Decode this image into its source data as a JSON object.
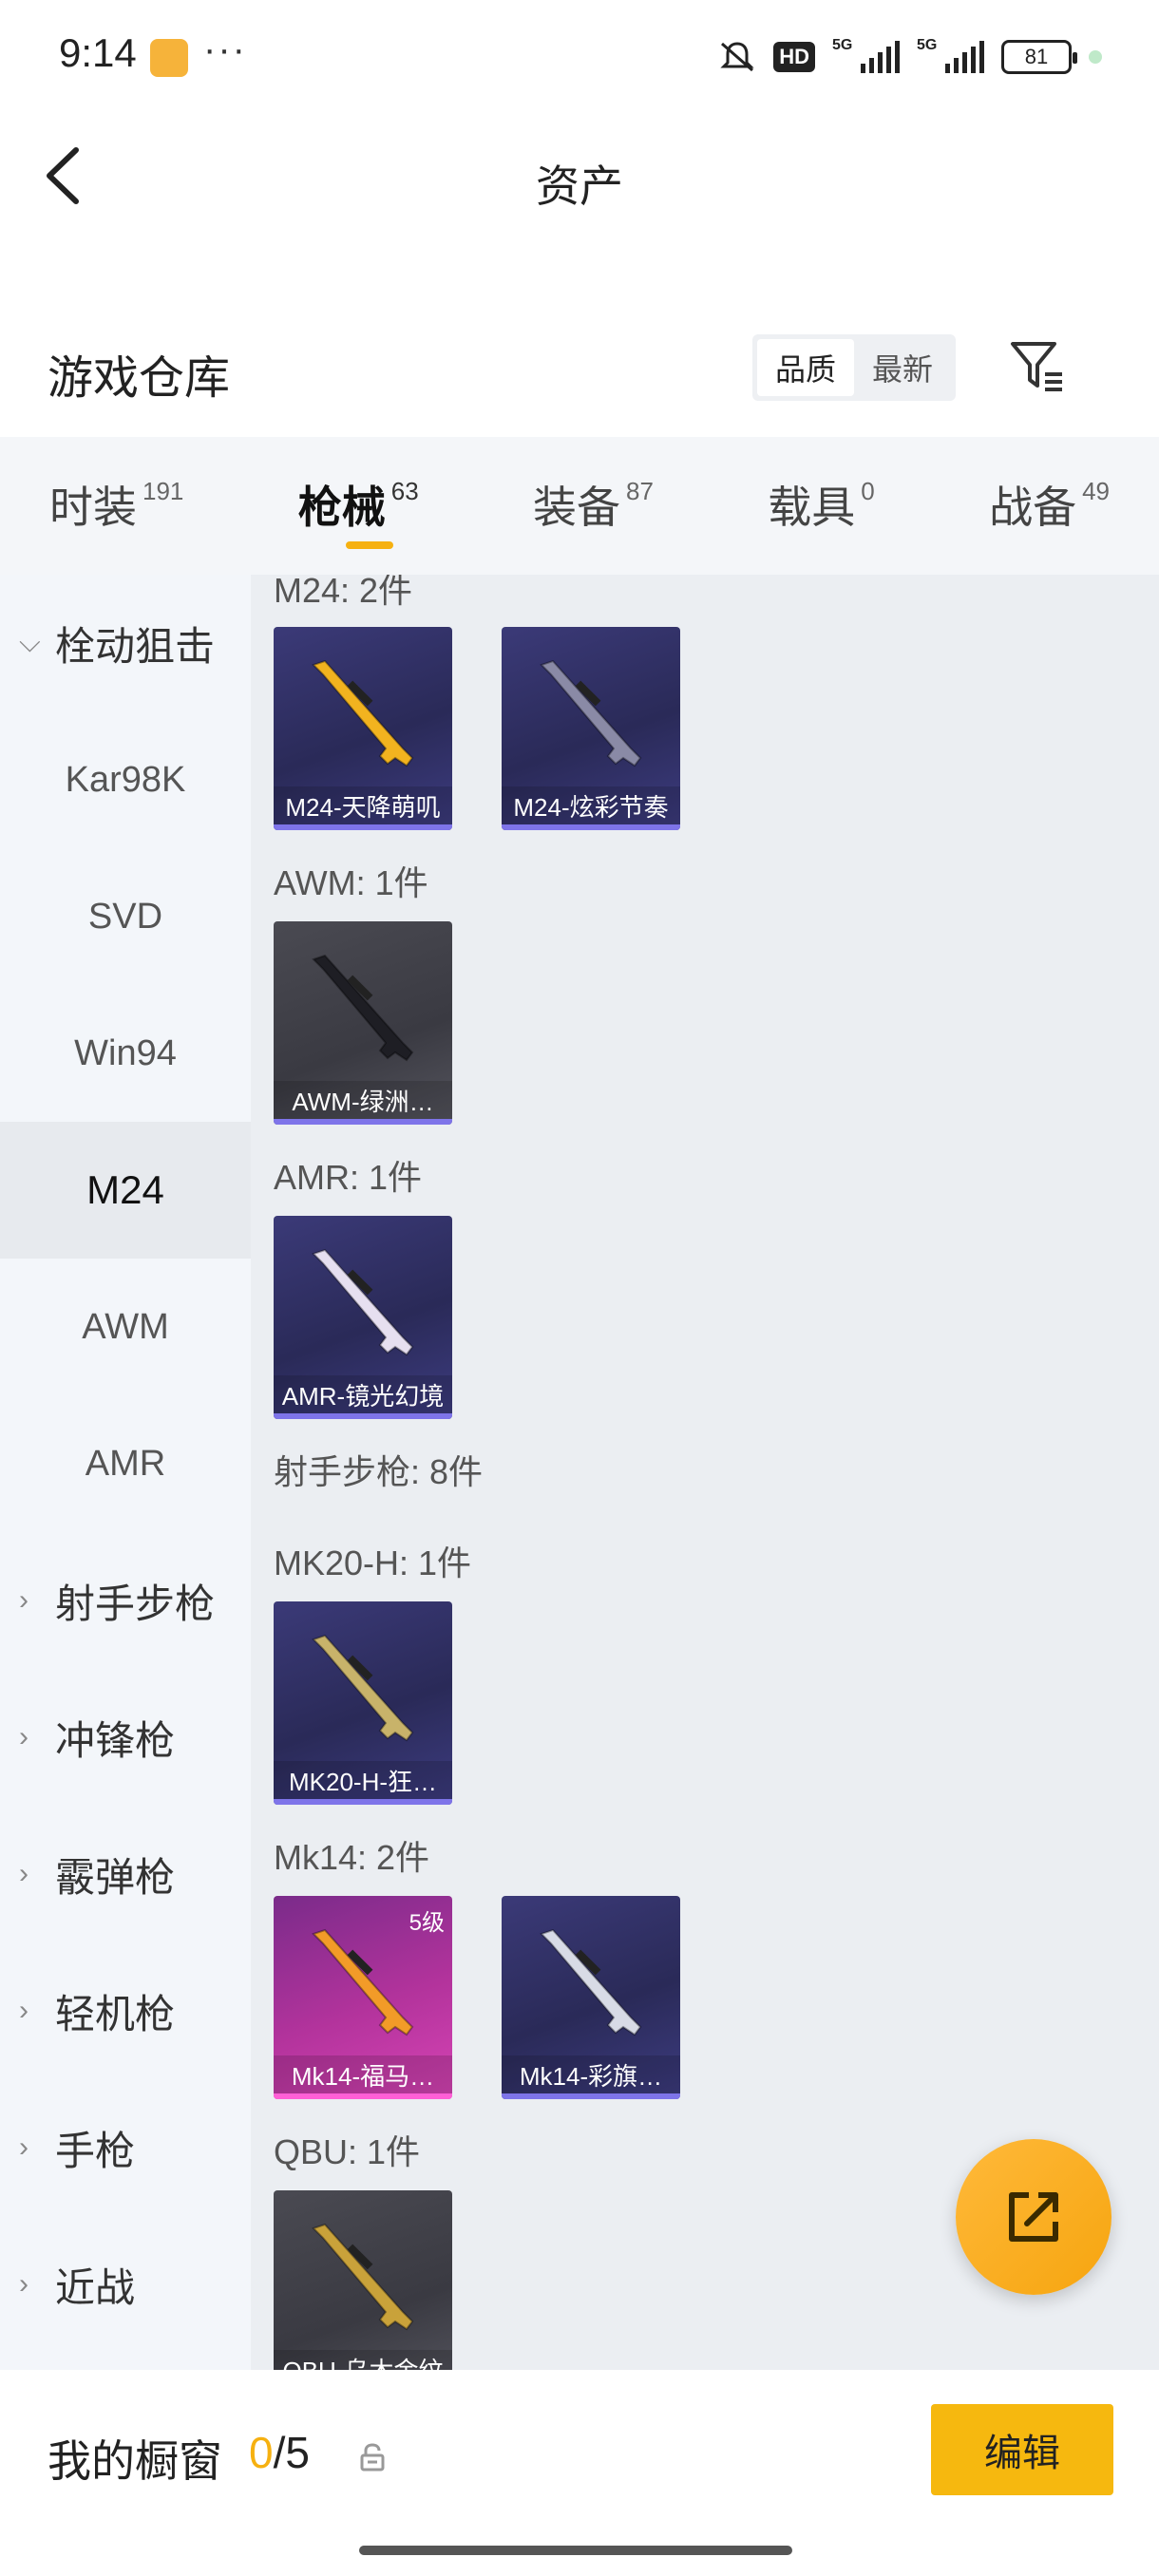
{
  "status": {
    "time": "9:14",
    "dots": "···",
    "hd": "HD",
    "net1": "5G",
    "net2": "5G",
    "battery": "81"
  },
  "header": {
    "title": "资产"
  },
  "warehouse": {
    "title": "游戏仓库",
    "sort_options": [
      "品质",
      "最新"
    ],
    "sort_selected": "品质"
  },
  "tabs": [
    {
      "label": "时装",
      "count": "191"
    },
    {
      "label": "枪械",
      "count": "63"
    },
    {
      "label": "装备",
      "count": "87"
    },
    {
      "label": "载具",
      "count": "0"
    },
    {
      "label": "战备",
      "count": "49"
    }
  ],
  "sidebar": {
    "group_open": "栓动狙击",
    "items": [
      "Kar98K",
      "SVD",
      "Win94",
      "M24",
      "AWM",
      "AMR"
    ],
    "active_item": "M24",
    "groups": [
      "射手步枪",
      "冲锋枪",
      "霰弹枪",
      "轻机枪",
      "手枪",
      "近战"
    ]
  },
  "content": {
    "groups": [
      {
        "label": "M24: 2件",
        "items": [
          {
            "name": "M24-天降萌叽",
            "style": "purple",
            "weapon_color": "#f2b31f"
          },
          {
            "name": "M24-炫彩节奏",
            "style": "purple",
            "weapon_color": "#8a8aa6"
          }
        ]
      },
      {
        "label": "AWM: 1件",
        "items": [
          {
            "name": "AWM-绿洲…",
            "style": "gray",
            "weapon_color": "#1e1e24"
          }
        ]
      },
      {
        "label": "AMR: 1件",
        "items": [
          {
            "name": "AMR-镜光幻境",
            "style": "purple",
            "weapon_color": "#e6dff0"
          }
        ]
      },
      {
        "label": "射手步枪: 8件",
        "items": []
      },
      {
        "label": "MK20-H: 1件",
        "items": [
          {
            "name": "MK20-H-狂…",
            "style": "purple",
            "weapon_color": "#c8b36a"
          }
        ]
      },
      {
        "label": "Mk14: 2件",
        "items": [
          {
            "name": "Mk14-福马…",
            "style": "pink",
            "weapon_color": "#f29b28",
            "level": "5级"
          },
          {
            "name": "Mk14-彩旗…",
            "style": "purple",
            "weapon_color": "#d8dbe6"
          }
        ]
      },
      {
        "label": "QBU: 1件",
        "items": [
          {
            "name": "QBU-乌木金纹",
            "style": "gray",
            "weapon_color": "#c9a23a"
          }
        ]
      }
    ]
  },
  "bottom": {
    "label": "我的橱窗",
    "current": "0",
    "total": "/5",
    "edit_label": "编辑"
  },
  "colors": {
    "accent": "#f6b111",
    "sidebar_bg": "#f3f6fa",
    "content_bg": "#ebeef2"
  }
}
